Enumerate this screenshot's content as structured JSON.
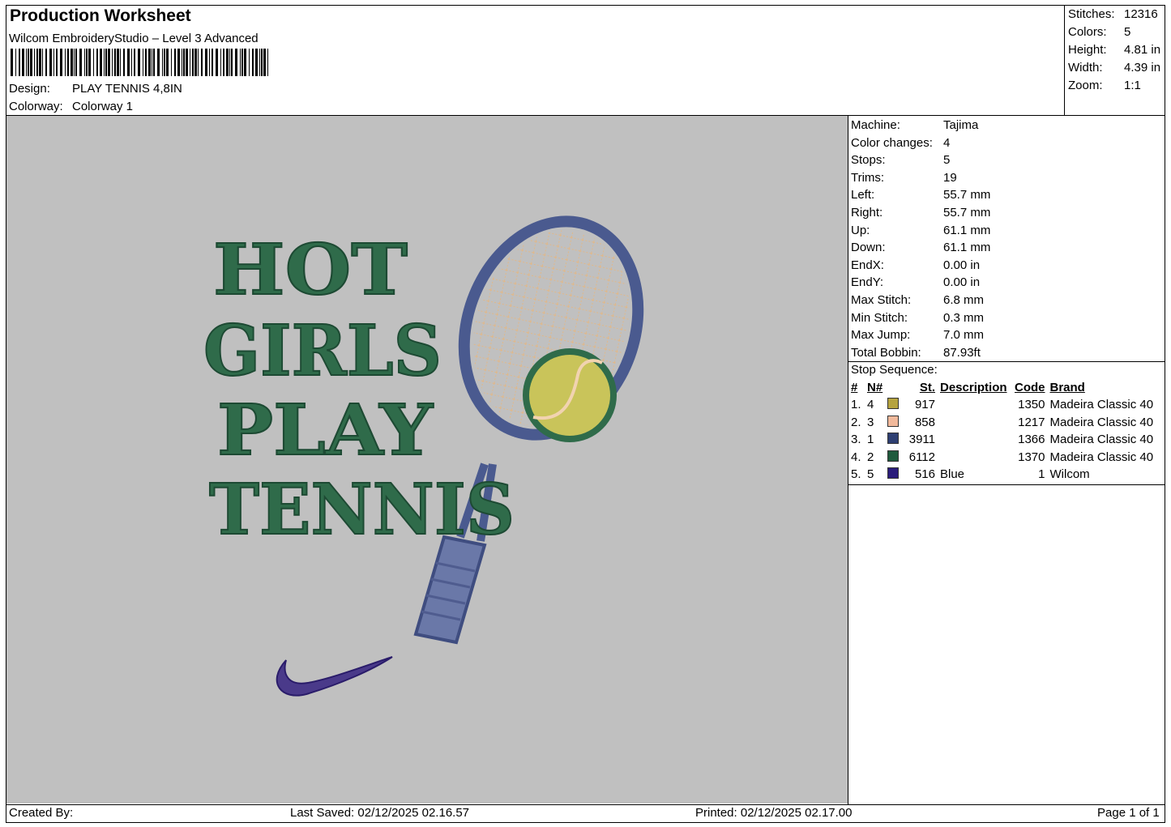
{
  "header": {
    "title": "Production Worksheet",
    "software": "Wilcom EmbroideryStudio – Level 3 Advanced",
    "design_label": "Design:",
    "design_value": "PLAY TENNIS 4,8IN",
    "colorway_label": "Colorway:",
    "colorway_value": "Colorway 1"
  },
  "stats": [
    {
      "label": "Stitches:",
      "value": "12316"
    },
    {
      "label": "Colors:",
      "value": "5"
    },
    {
      "label": "Height:",
      "value": "4.81 in"
    },
    {
      "label": "Width:",
      "value": "4.39 in"
    },
    {
      "label": "Zoom:",
      "value": "1:1"
    }
  ],
  "machine_info": [
    {
      "label": "Machine:",
      "value": "Tajima"
    },
    {
      "label": "Color changes:",
      "value": "4"
    },
    {
      "label": "Stops:",
      "value": "5"
    },
    {
      "label": "Trims:",
      "value": "19"
    },
    {
      "label": "Left:",
      "value": "55.7 mm"
    },
    {
      "label": "Right:",
      "value": "55.7 mm"
    },
    {
      "label": "Up:",
      "value": "61.1 mm"
    },
    {
      "label": "Down:",
      "value": "61.1 mm"
    },
    {
      "label": "EndX:",
      "value": "0.00 in"
    },
    {
      "label": "EndY:",
      "value": "0.00 in"
    },
    {
      "label": "Max Stitch:",
      "value": "6.8 mm"
    },
    {
      "label": "Min Stitch:",
      "value": "0.3 mm"
    },
    {
      "label": "Max Jump:",
      "value": "7.0 mm"
    },
    {
      "label": "Total Bobbin:",
      "value": "87.93ft"
    }
  ],
  "stop_sequence": {
    "title": "Stop Sequence:",
    "headers": [
      "#",
      "N#",
      "St.",
      "Description",
      "Code",
      "Brand"
    ],
    "rows": [
      {
        "num": "1.",
        "n": "4",
        "color": "#b5a33f",
        "st": "917",
        "desc": "",
        "code": "1350",
        "brand": "Madeira Classic 40"
      },
      {
        "num": "2.",
        "n": "3",
        "color": "#f1b99b",
        "st": "858",
        "desc": "",
        "code": "1217",
        "brand": "Madeira Classic 40"
      },
      {
        "num": "3.",
        "n": "1",
        "color": "#2e3f72",
        "st": "3911",
        "desc": "",
        "code": "1366",
        "brand": "Madeira Classic 40"
      },
      {
        "num": "4.",
        "n": "2",
        "color": "#1f5a3d",
        "st": "6112",
        "desc": "",
        "code": "1370",
        "brand": "Madeira Classic 40"
      },
      {
        "num": "5.",
        "n": "5",
        "color": "#2a1c7a",
        "st": "516",
        "desc": "Blue",
        "code": "1",
        "brand": "Wilcom"
      }
    ]
  },
  "design": {
    "lines": [
      "HOT",
      "GIRLS",
      "PLAY",
      "TENNIS"
    ],
    "text_color": "#2f6b4a",
    "frame_color": "#4a5a8f",
    "string_color": "#e0b88a",
    "ball_color": "#c9c45a",
    "swoosh_color": "#4a3a8a"
  },
  "footer": {
    "created_by": "Created By:",
    "last_saved": "Last Saved: 02/12/2025 02.16.57",
    "printed": "Printed: 02/12/2025 02.17.00",
    "page": "Page 1 of 1"
  }
}
